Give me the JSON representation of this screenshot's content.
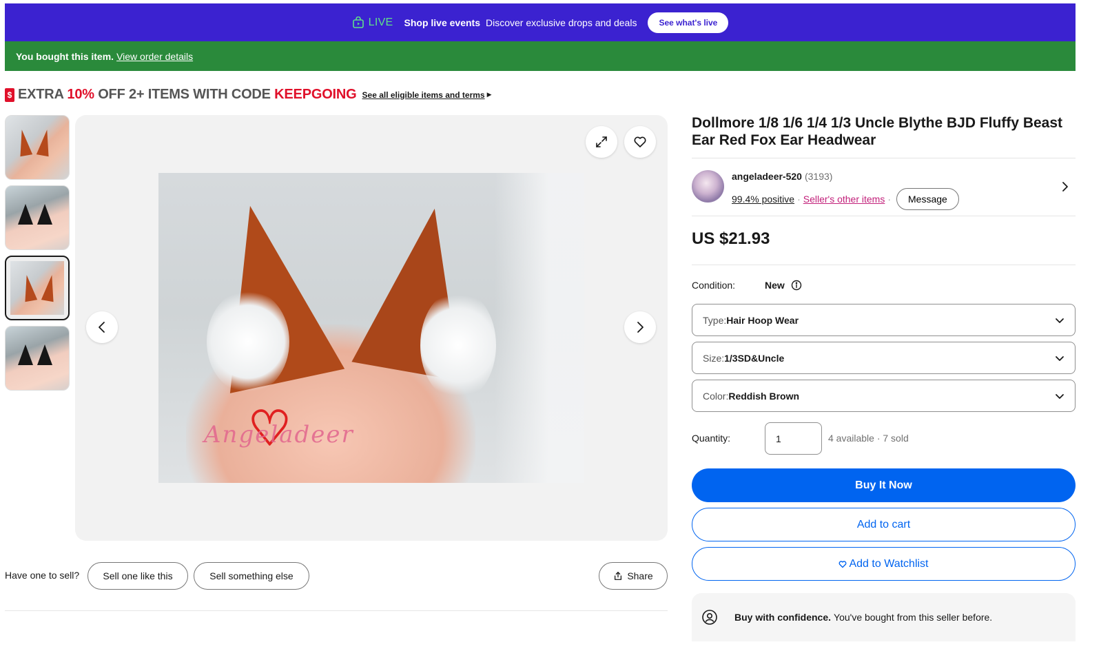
{
  "live_banner": {
    "live_label": "LIVE",
    "title": "Shop live events",
    "description": "Discover exclusive drops and deals",
    "button": "See what's live",
    "bg_color": "#3b22d0"
  },
  "bought_bar": {
    "message": "You bought this item.",
    "link": "View order details",
    "bg_color": "#2a8a3b"
  },
  "promo": {
    "icon": "coupon-icon",
    "part1": "EXTRA ",
    "percent": "10%",
    "part2": " OFF 2+ ITEMS WITH CODE ",
    "code": "KEEPGOING",
    "link": "See all eligible items and terms"
  },
  "gallery": {
    "thumbnails": [
      {
        "label": "red-fox-ear-photo",
        "selected": false
      },
      {
        "label": "black-ear-photo",
        "selected": false
      },
      {
        "label": "red-fox-ear-photo",
        "selected": true
      },
      {
        "label": "black-ear-photo",
        "selected": false
      }
    ],
    "watermark": "Angeladeer",
    "icons": {
      "expand": "expand-icon",
      "watch": "heart-icon",
      "prev": "chevron-left-icon",
      "next": "chevron-right-icon"
    }
  },
  "sell": {
    "question": "Have one to sell?",
    "sell_like": "Sell one like this",
    "sell_else": "Sell something else",
    "share": "Share"
  },
  "item": {
    "title": "Dollmore 1/8 1/6 1/4 1/3 Uncle Blythe BJD Fluffy Beast Ear Red Fox Ear Headwear",
    "price": "US $21.93"
  },
  "seller": {
    "name": "angeladeer-520",
    "count": "(3193)",
    "positive": "99.4% positive",
    "other_items": "Seller's other items",
    "message": "Message"
  },
  "condition": {
    "label": "Condition:",
    "value": "New"
  },
  "selects": [
    {
      "key": "Type: ",
      "value": "Hair Hoop Wear"
    },
    {
      "key": "Size: ",
      "value": "1/3SD&Uncle"
    },
    {
      "key": "Color: ",
      "value": "Reddish Brown"
    }
  ],
  "quantity": {
    "label": "Quantity:",
    "value": "1",
    "availability": "4 available · 7 sold"
  },
  "actions": {
    "buy_now": "Buy It Now",
    "add_to_cart": "Add to cart",
    "add_to_watchlist": "Add to Watchlist",
    "accent_color": "#0064f0"
  },
  "confidence": {
    "title": "Buy with confidence.",
    "text": "You've bought from this seller before."
  }
}
